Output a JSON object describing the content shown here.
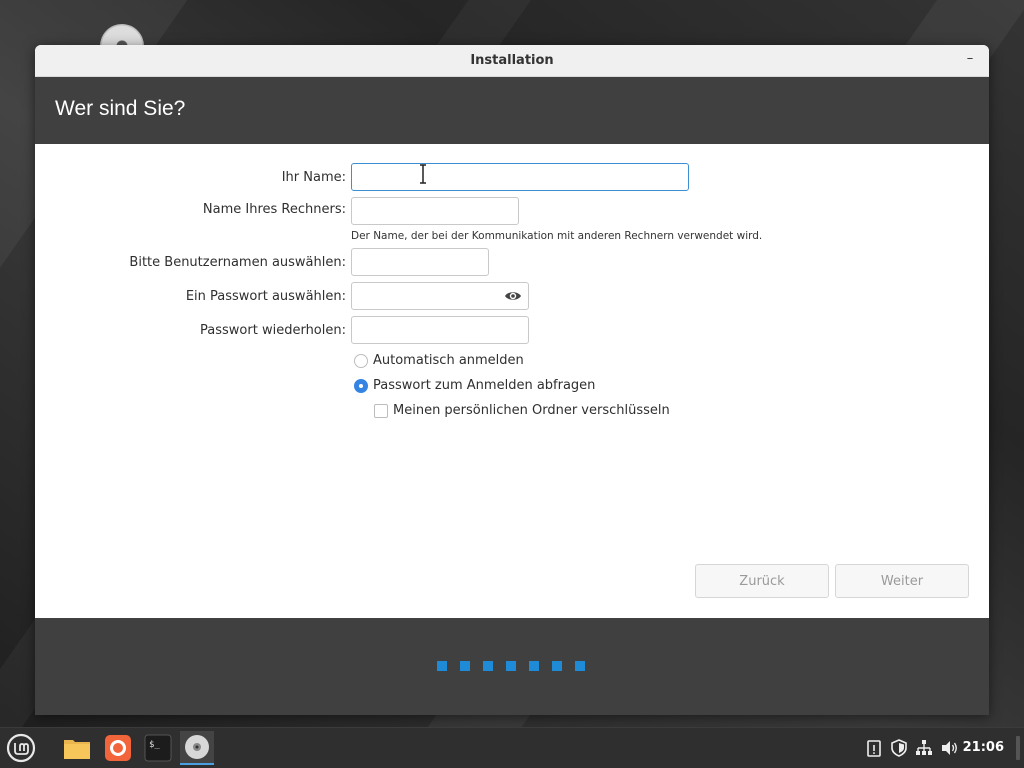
{
  "window": {
    "title": "Installation",
    "minimize": "–"
  },
  "header": {
    "title": "Wer sind Sie?"
  },
  "form": {
    "name_label": "Ihr Name:",
    "name_value": "",
    "computer_label": "Name Ihres Rechners:",
    "computer_value": "",
    "computer_hint": "Der Name, der bei der Kommunikation mit anderen Rechnern verwendet wird.",
    "username_label": "Bitte Benutzernamen auswählen:",
    "username_value": "",
    "password_label": "Ein Passwort auswählen:",
    "password_value": "",
    "password_repeat_label": "Passwort wiederholen:",
    "password_repeat_value": "",
    "auto_login_label": "Automatisch anmelden",
    "ask_password_label": "Passwort zum Anmelden abfragen",
    "encrypt_home_label": "Meinen persönlichen Ordner verschlüsseln"
  },
  "buttons": {
    "back": "Zurück",
    "next": "Weiter"
  },
  "progress": {
    "steps": 7,
    "current": 7
  },
  "taskbar": {
    "clock": "21:06",
    "apps": [
      "linux-mint-menu-icon",
      "files-folder-icon",
      "firefox-icon",
      "terminal-icon",
      "installer-disc-icon"
    ],
    "terminal_glyph": "$_"
  },
  "colors": {
    "accent": "#3584e4",
    "header": "#404040",
    "progress": "#1f8ad6"
  }
}
